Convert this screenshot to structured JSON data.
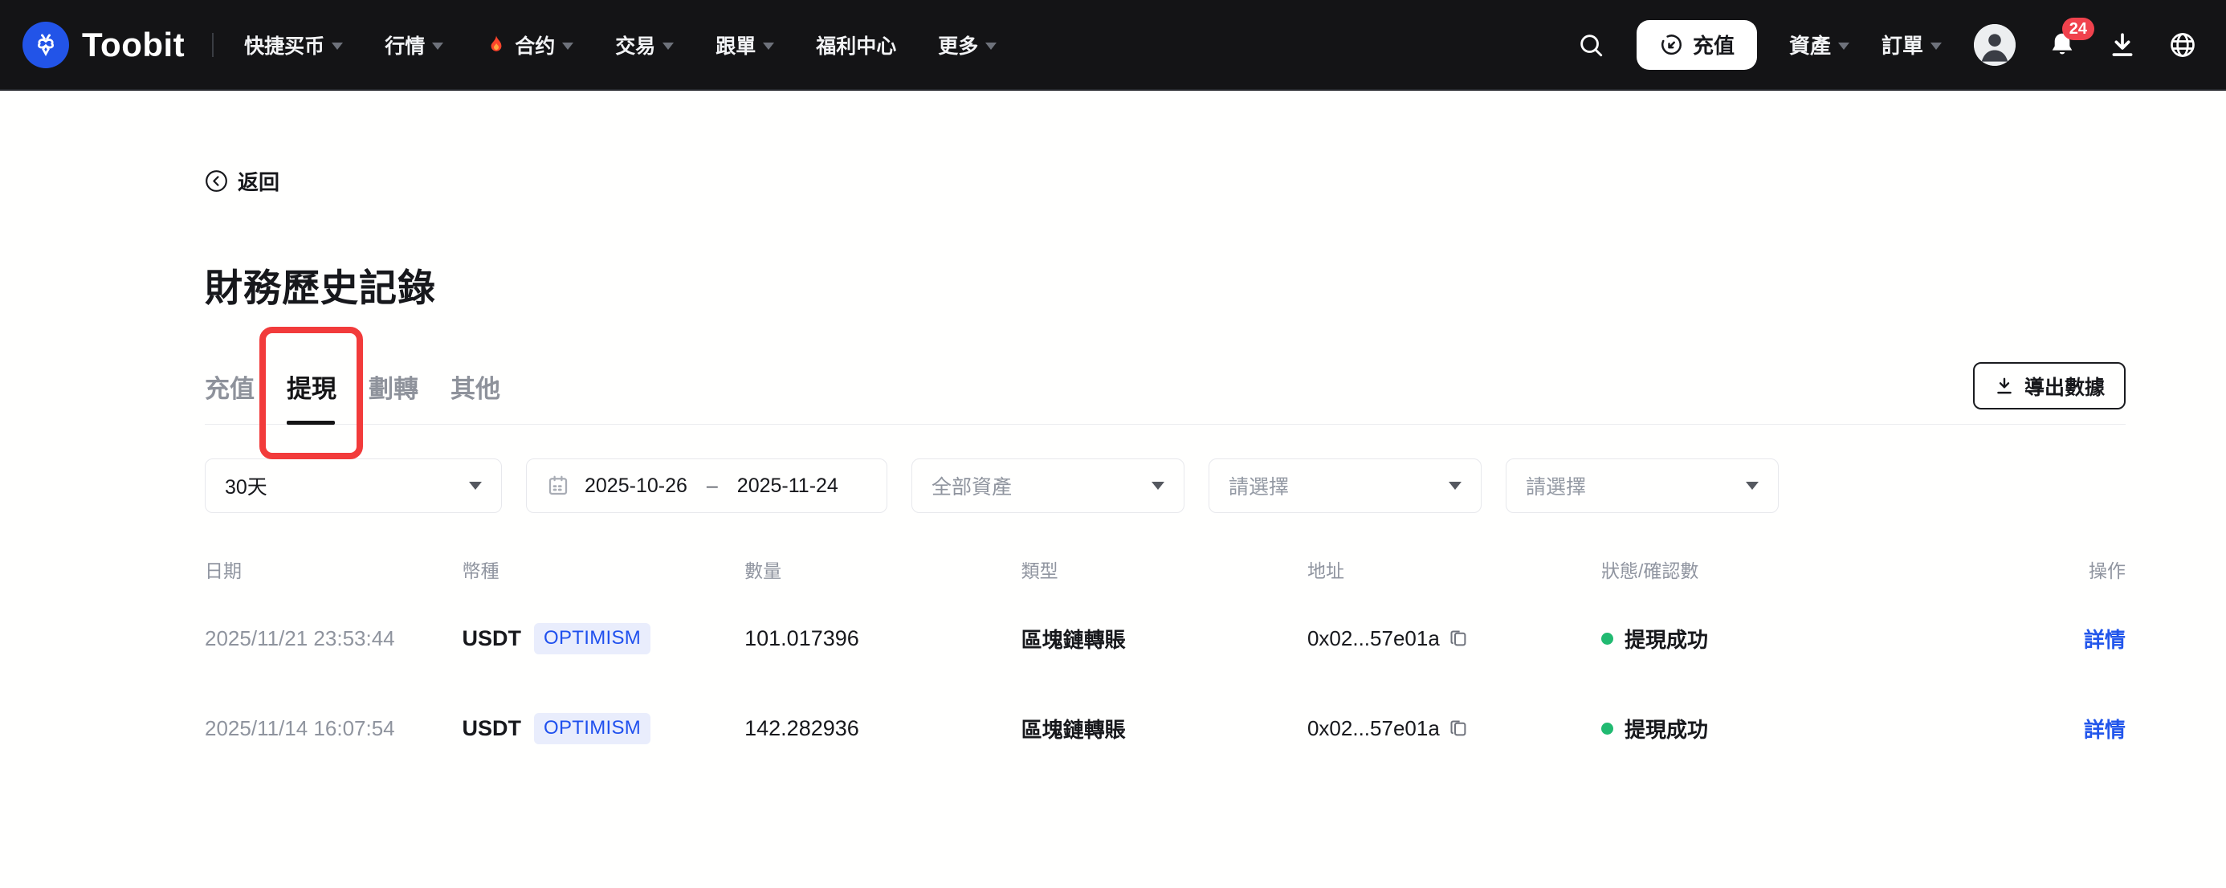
{
  "nav": {
    "brand": "Toobit",
    "menu": [
      {
        "label": "快捷买币"
      },
      {
        "label": "行情"
      },
      {
        "label": "合约"
      },
      {
        "label": "交易"
      },
      {
        "label": "跟單"
      },
      {
        "label": "福利中心"
      },
      {
        "label": "更多"
      }
    ],
    "deposit_button_label": "充值",
    "assets_label": "資產",
    "orders_label": "訂單",
    "notification_count": "24"
  },
  "page": {
    "back_label": "返回",
    "title": "財務歷史記錄",
    "tabs": [
      {
        "label": "充值"
      },
      {
        "label": "提現"
      },
      {
        "label": "劃轉"
      },
      {
        "label": "其他"
      }
    ],
    "active_tab": "提現",
    "export_label": "導出數據"
  },
  "filters": {
    "period": "30天",
    "date_from": "2025-10-26",
    "date_separator": "–",
    "date_to": "2025-11-24",
    "asset": "全部資產",
    "select_placeholder_1": "請選擇",
    "select_placeholder_2": "請選擇"
  },
  "table": {
    "headers": {
      "date": "日期",
      "coin": "幣種",
      "amount": "數量",
      "type": "類型",
      "address": "地址",
      "status": "狀態/確認數",
      "action": "操作"
    },
    "rows": [
      {
        "date": "2025/11/21 23:53:44",
        "coin": "USDT",
        "network": "OPTIMISM",
        "amount": "101.017396",
        "type": "區塊鏈轉賬",
        "address": "0x02...57e01a",
        "status": "提現成功",
        "action": "詳情"
      },
      {
        "date": "2025/11/14 16:07:54",
        "coin": "USDT",
        "network": "OPTIMISM",
        "amount": "142.282936",
        "type": "區塊鏈轉賬",
        "address": "0x02...57e01a",
        "status": "提現成功",
        "action": "詳情"
      }
    ]
  },
  "colors": {
    "nav_bg": "#141416",
    "accent_blue": "#2256eb",
    "tag_bg": "#e9edfc",
    "success_green": "#21ba71",
    "annotation_red": "#f23b3b",
    "badge_red": "#f0424d"
  }
}
